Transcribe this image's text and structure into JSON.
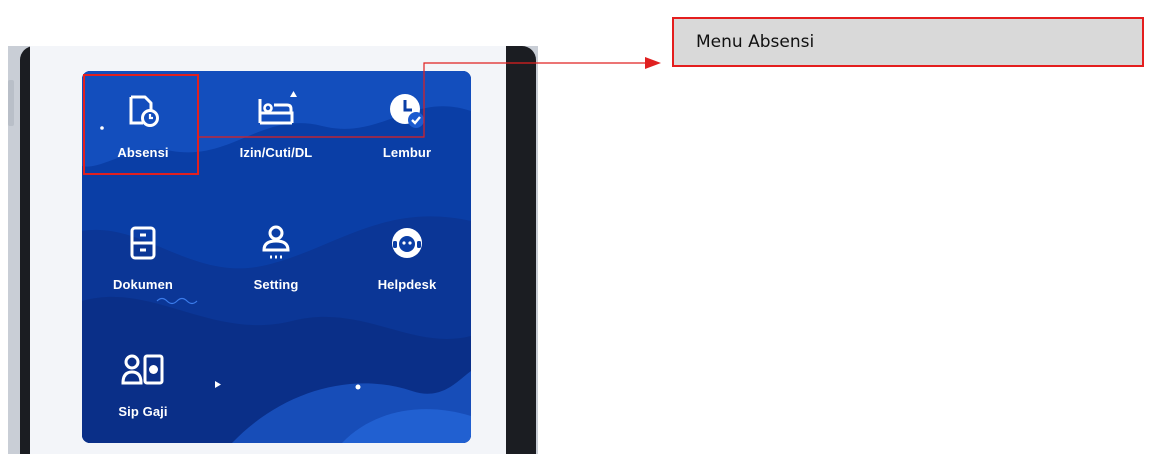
{
  "callout": {
    "text": "Menu Absensi"
  },
  "menu": {
    "items": [
      {
        "label": "Absensi",
        "icon": "attendance-clock-icon"
      },
      {
        "label": "Izin/Cuti/DL",
        "icon": "bed-icon"
      },
      {
        "label": "Lembur",
        "icon": "clock-check-icon"
      },
      {
        "label": "Dokumen",
        "icon": "cabinet-icon"
      },
      {
        "label": "Setting",
        "icon": "user-settings-icon"
      },
      {
        "label": "Helpdesk",
        "icon": "headset-icon"
      },
      {
        "label": "Sip Gaji",
        "icon": "payslip-icon"
      }
    ]
  },
  "colors": {
    "card_blue": "#0a3ea6",
    "card_dark": "#062a7a",
    "highlight_red": "#e02020",
    "callout_bg": "#d9d9d9"
  }
}
